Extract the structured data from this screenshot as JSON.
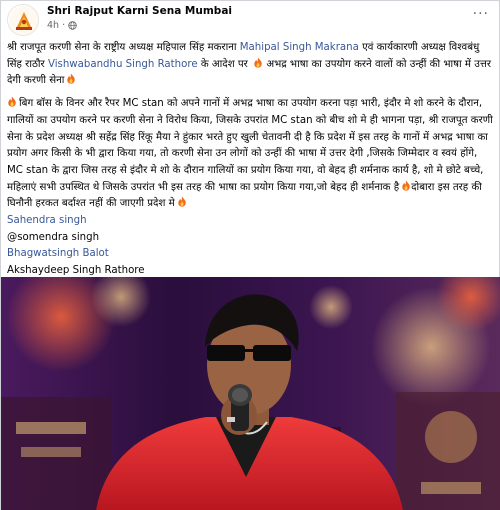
{
  "post": {
    "page_name": "Shri Rajput Karni Sena Mumbai",
    "time": "4h",
    "more_glyph": "···",
    "para1": {
      "t1": "श्री राजपूत करणी सेना के राष्ट्रीय अध्यक्ष महिपाल सिंह मकराना ",
      "link1": "Mahipal Singh Makrana",
      "t2": " एवं कार्यकारणी अध्यक्ष विश्वबंधु सिंह राठौर ",
      "link2": "Vishwabandhu Singh Rathore",
      "t3": " के आदेश पर ",
      "t4": " अभद्र भाषा का उपयोग करने वालों को उन्हीं की भाषा में उत्तर देगी करणी सेना"
    },
    "para2": {
      "text": "बिग बॉस के विनर और रैपर MC stan को अपने गानों में अभद्र भाषा का उपयोग करना पड़ा भारी, इंदौर मे शो करने के दौरान, गालियों का उपयोग करने पर करणी सेना ने विरोध किया, जिसके उपरांत MC stan को बीच शो मे ही भागना पड़ा, श्री राजपूत करणी सेना के प्रदेश अध्यक्ष श्री सहेंद्र सिंह रिंकू मैया ने हुंकार भरते हुए खुली चेतावनी दी है कि प्रदेश में इस तरह के गानों में अभद्र भाषा का प्रयोग अगर किसी के भी द्वारा किया गया, तो करणी सेना उन लोगों को उन्हीं की भाषा में उत्तर देगी ,जिसके जिम्मेदार व स्वयं होंगे, MC stan के द्वारा जिस तरह से इंदौर मे शो के दौरान गालियों का प्रयोग किया गया, वो बेहद ही शर्मनाक कार्य है, शो मे छोटे बच्चे, महिलाएं सभी उपस्थित थे जिसके उपरांत भी इस तरह की भाषा का प्रयोग किया गया,जो बेहद ही शर्मनाक है",
      "text_end": "दोबारा इस तरह की घिनौनी हरकत बर्दाश्त नहीं की जाएगी प्रदेश मे"
    },
    "tags": [
      {
        "label": "Sahendra singh",
        "link": true
      },
      {
        "label": "@somendra singh",
        "link": false
      },
      {
        "label": "Bhagwatsingh Balot",
        "link": true
      },
      {
        "label": "Akshaydeep Singh Rathore",
        "link": false
      }
    ]
  },
  "icons": {
    "globe": "globe-icon",
    "fire": "fire-emoji",
    "more": "more-options-icon",
    "avatar": "karni-sena-logo"
  },
  "colors": {
    "link": "#385898",
    "meta": "#65676b",
    "text": "#050505",
    "jacket": "#e0242a",
    "background_stage": "#3d1250"
  }
}
